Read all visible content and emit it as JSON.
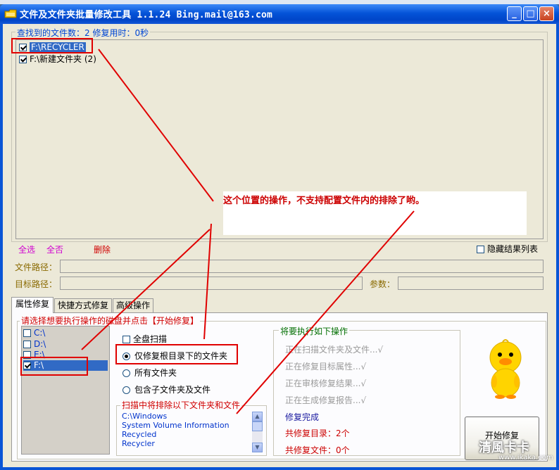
{
  "desktop": {
    "top_text": "Bing.mail@163.com"
  },
  "window": {
    "title": "文件及文件夹批量修改工具 1.1.24   Bing.mail@163.com",
    "minimize": "_",
    "maximize": "□",
    "close": "×"
  },
  "results": {
    "legend": "查找到的文件数：2    修复用时：0秒",
    "items": [
      {
        "label": "F:\\RECYCLER",
        "checked": true,
        "selected": true
      },
      {
        "label": "F:\\新建文件夹 (2)",
        "checked": true,
        "selected": false
      }
    ]
  },
  "actions": {
    "select_all": "全选",
    "select_none": "全否",
    "delete": "删除",
    "hide_results": "隐藏结果列表"
  },
  "paths": {
    "file_label": "文件路径：",
    "file_value": "",
    "target_label": "目标路径：",
    "target_value": "",
    "params_label": "参数：",
    "params_value": ""
  },
  "tabs": [
    {
      "label": "属性修复"
    },
    {
      "label": "快捷方式修复"
    },
    {
      "label": "高级操作"
    }
  ],
  "disk": {
    "legend": "请选择想要执行操作的磁盘并点击【开始修复】",
    "drives": [
      {
        "label": "C:\\",
        "checked": false
      },
      {
        "label": "D:\\",
        "checked": false
      },
      {
        "label": "E:\\",
        "checked": false
      },
      {
        "label": "F:\\",
        "checked": true
      }
    ]
  },
  "options": {
    "full_scan": "全盘扫描",
    "root_only": "仅修复根目录下的文件夹",
    "all_folders": "所有文件夹",
    "with_subfolders": "包含子文件夹及文件",
    "selected": "root_only"
  },
  "exclude": {
    "legend": "扫描中将排除以下文件夹和文件",
    "items": [
      "C:\\Windows",
      "System Volume Information",
      "Recycled",
      "Recycler"
    ]
  },
  "operations": {
    "legend": "将要执行如下操作",
    "steps": [
      "正在扫描文件夹及文件...√",
      "正在修复目标属性...√",
      "正在审核修复结果...√",
      "正在生成修复报告...√"
    ],
    "done": "修复完成",
    "total_dirs": "共修复目录：2个",
    "total_files": "共修复文件：0个"
  },
  "start_button": "开始修复",
  "annotation": {
    "text": "这个位置的操作，不支持配置文件内的排除了哟。"
  },
  "watermark": {
    "brand": "清風卡卡",
    "url": "www.ikaka.com"
  },
  "colors": {
    "title_bar": "#0453d8",
    "annotation": "#cc0000",
    "selection": "#316ac5"
  }
}
